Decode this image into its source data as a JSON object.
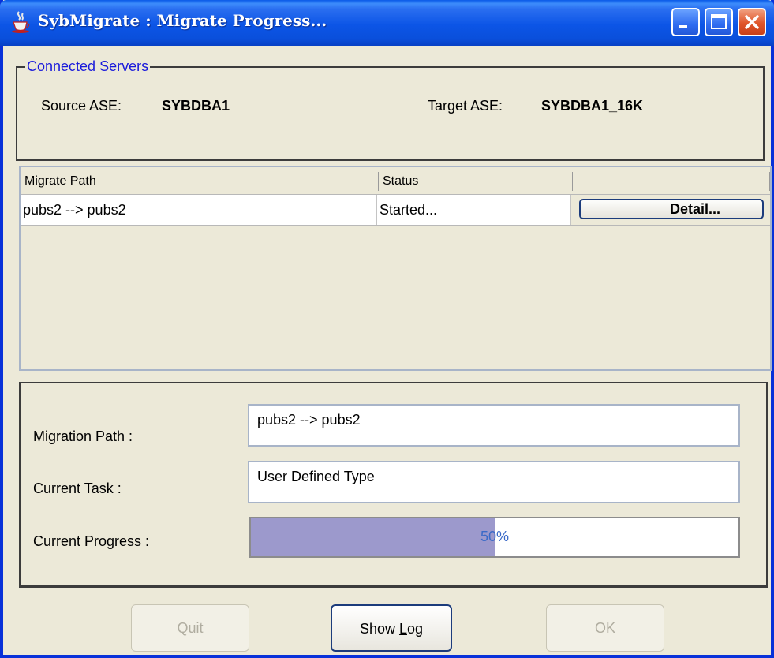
{
  "window": {
    "title": "SybMigrate : Migrate Progress...",
    "app_icon": "java-cup-icon",
    "controls": [
      "minimize",
      "maximize",
      "close"
    ]
  },
  "servers": {
    "legend": "Connected Servers",
    "source_label": "Source ASE:",
    "source_value": "SYBDBA1",
    "target_label": "Target ASE:",
    "target_value": "SYBDBA1_16K"
  },
  "table": {
    "columns": [
      "Migrate Path",
      "Status",
      ""
    ],
    "rows": [
      {
        "path": "pubs2 --> pubs2",
        "status": "Started...",
        "action": "Detail..."
      }
    ]
  },
  "progress": {
    "path_label": "Migration Path :",
    "path_value": "pubs2 --> pubs2",
    "task_label": "Current Task :",
    "task_value": "User Defined Type",
    "progress_label": "Current Progress :",
    "progress_percent": 50,
    "progress_text": "50%"
  },
  "buttons": {
    "quit": {
      "label_pre": "",
      "label_ul": "Q",
      "label_post": "uit",
      "enabled": false
    },
    "show_log": {
      "label_pre": "Show ",
      "label_ul": "L",
      "label_post": "og",
      "enabled": true
    },
    "ok": {
      "label_pre": "",
      "label_ul": "O",
      "label_post": "K",
      "enabled": false
    }
  },
  "colors": {
    "title_bar": "#0c55e6",
    "legend_text": "#1a1adb",
    "progress_fill": "#9c99cc",
    "progress_text": "#3a6ac8"
  }
}
